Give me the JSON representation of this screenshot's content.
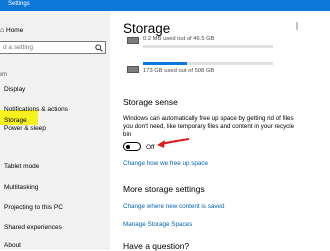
{
  "window": {
    "title": "Settings"
  },
  "sidebar": {
    "home_label": "Home",
    "search_placeholder": "d a setting",
    "group_label": "tem",
    "items": [
      {
        "label": "Display"
      },
      {
        "label": "Notifications & actions"
      },
      {
        "label": "Power & sleep"
      },
      {
        "label": "Storage",
        "selected": true
      },
      {
        "label": "Tablet mode"
      },
      {
        "label": "Multitasking"
      },
      {
        "label": "Projecting to this PC"
      },
      {
        "label": "Shared experiences"
      },
      {
        "label": "About"
      }
    ]
  },
  "main": {
    "title": "Storage",
    "drives": [
      {
        "usage_text": "0.2 MB used out of 46.5 GB",
        "used_fraction": 0.0
      },
      {
        "usage_text": "173 GB used out of 508 GB",
        "used_fraction": 0.34
      }
    ],
    "storage_sense": {
      "heading": "Storage sense",
      "description": "Windows can automatically free up space by getting rid of files you don't need, like temporary files and content in your recycle bin",
      "toggle_state": "Off",
      "link": "Change how we free up space"
    },
    "more_settings": {
      "heading": "More storage settings",
      "links": [
        "Change where new content is saved",
        "Manage Storage Spaces"
      ]
    },
    "question_heading": "Have a question?"
  },
  "colors": {
    "titlebar": "#0b78d7",
    "accent_link": "#0063b1",
    "highlight": "#f7f21f",
    "arrow": "#e01b1b"
  }
}
